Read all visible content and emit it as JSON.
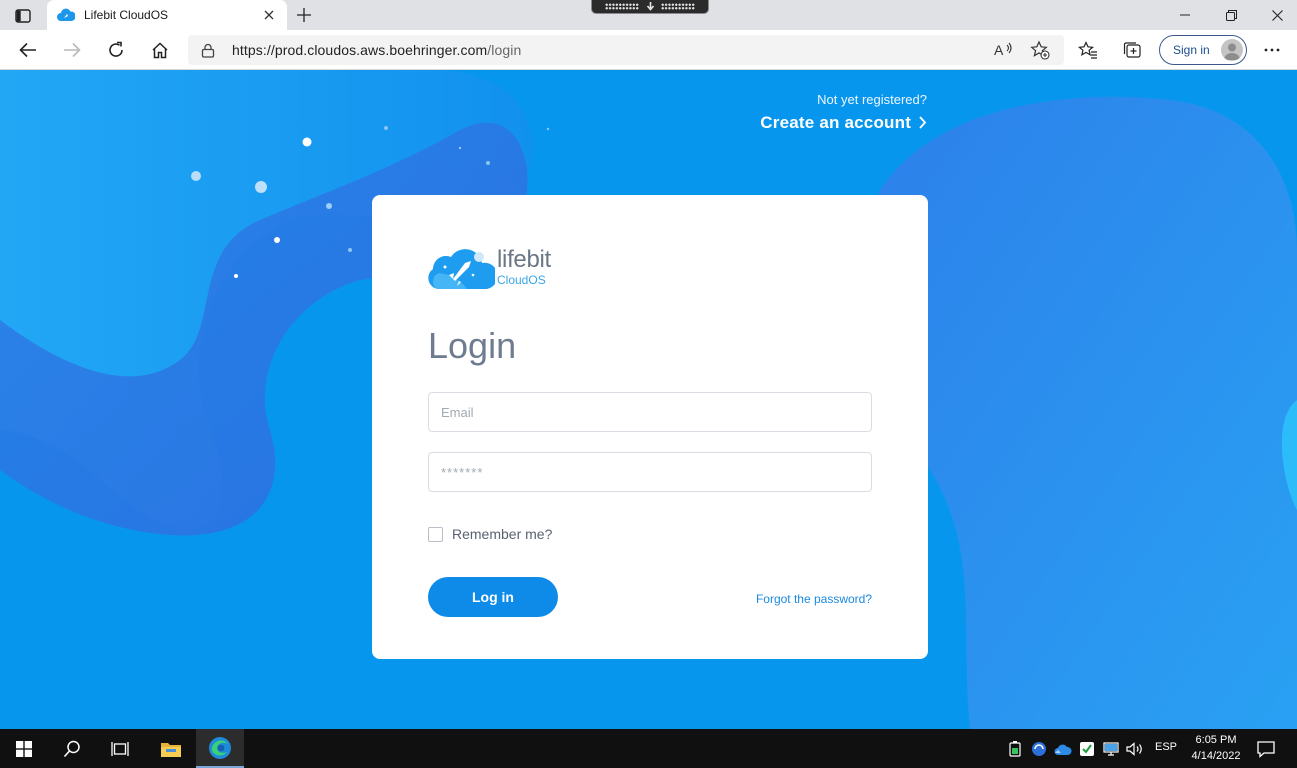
{
  "browser": {
    "tab": {
      "title": "Lifebit CloudOS",
      "close_icon": "close-icon"
    },
    "url": {
      "host": "https://prod.cloudos.aws.boehringer.com",
      "path": "/login"
    },
    "sign_in_label": "Sign in"
  },
  "page": {
    "header": {
      "question": "Not yet registered?",
      "create_account": "Create an account"
    },
    "logo": {
      "brand": "lifebit",
      "brand_sub": "CloudOS"
    },
    "login_title": "Login",
    "email": {
      "placeholder": "Email",
      "value": ""
    },
    "password": {
      "placeholder": "*******",
      "value": ""
    },
    "remember_label": "Remember me?",
    "remember_checked": false,
    "login_button": "Log in",
    "forgot_link": "Forgot the password?"
  },
  "taskbar": {
    "language": "ESP",
    "time": "6:05 PM",
    "date": "4/14/2022"
  },
  "colors": {
    "page_bg": "#0796ee",
    "accent": "#0e8ae8",
    "link": "#1a8ae0"
  }
}
